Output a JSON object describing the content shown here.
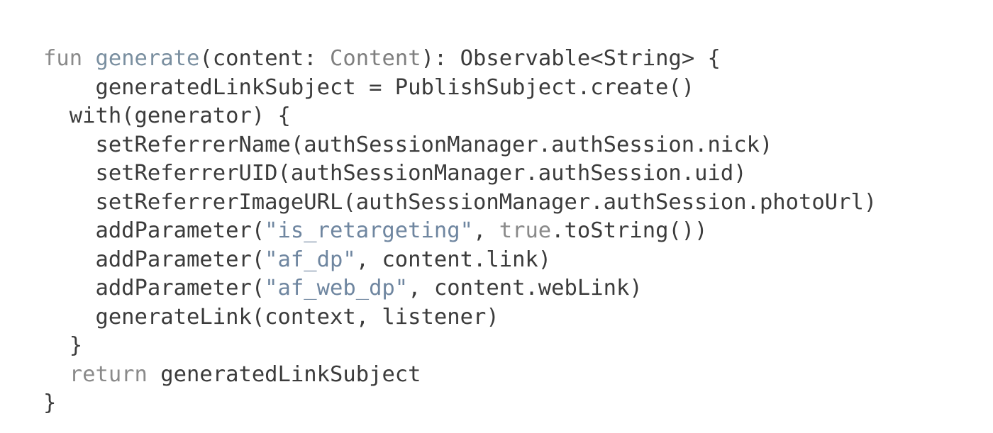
{
  "code": {
    "lines": [
      [
        {
          "t": "fun",
          "k": "keyword"
        },
        {
          "t": " ",
          "k": "plain"
        },
        {
          "t": "generate",
          "k": "func"
        },
        {
          "t": "(content: ",
          "k": "plain"
        },
        {
          "t": "Content",
          "k": "type"
        },
        {
          "t": "): Observable<String> {",
          "k": "plain"
        }
      ],
      [
        {
          "t": "    generatedLinkSubject = PublishSubject.create()",
          "k": "plain"
        }
      ],
      [
        {
          "t": "  with(generator) {",
          "k": "plain"
        }
      ],
      [
        {
          "t": "    setReferrerName(authSessionManager.authSession.nick)",
          "k": "plain"
        }
      ],
      [
        {
          "t": "    setReferrerUID(authSessionManager.authSession.uid)",
          "k": "plain"
        }
      ],
      [
        {
          "t": "    setReferrerImageURL(authSessionManager.authSession.photoUrl)",
          "k": "plain"
        }
      ],
      [
        {
          "t": "    addParameter(",
          "k": "plain"
        },
        {
          "t": "\"is_retargeting\"",
          "k": "string"
        },
        {
          "t": ", ",
          "k": "plain"
        },
        {
          "t": "true",
          "k": "keyword"
        },
        {
          "t": ".toString())",
          "k": "plain"
        }
      ],
      [
        {
          "t": "    addParameter(",
          "k": "plain"
        },
        {
          "t": "\"af_dp\"",
          "k": "string"
        },
        {
          "t": ", content.link)",
          "k": "plain"
        }
      ],
      [
        {
          "t": "    addParameter(",
          "k": "plain"
        },
        {
          "t": "\"af_web_dp\"",
          "k": "string"
        },
        {
          "t": ", content.webLink)",
          "k": "plain"
        }
      ],
      [
        {
          "t": "    generateLink(context, listener)",
          "k": "plain"
        }
      ],
      [
        {
          "t": "  }",
          "k": "plain"
        }
      ],
      [
        {
          "t": "  ",
          "k": "plain"
        },
        {
          "t": "return",
          "k": "keyword"
        },
        {
          "t": " generatedLinkSubject",
          "k": "plain"
        }
      ],
      [
        {
          "t": "}",
          "k": "plain"
        }
      ]
    ]
  }
}
